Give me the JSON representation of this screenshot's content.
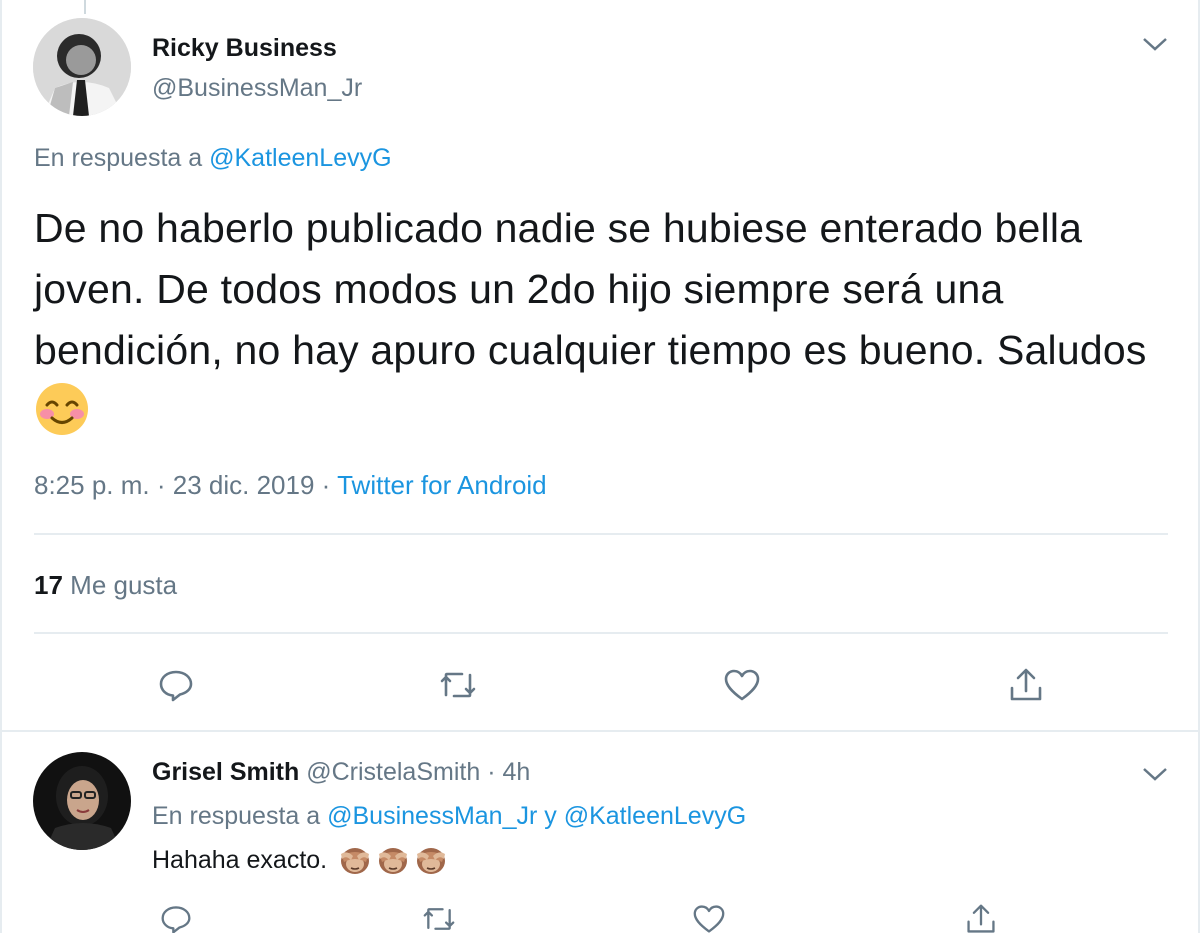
{
  "tweet": {
    "author_name": "Ricky Business",
    "author_handle": "@BusinessMan_Jr",
    "reply_prefix": "En respuesta a",
    "reply_to": "@KatleenLevyG",
    "text": "De no haberlo publicado nadie se hubiese enterado bella joven. De todos modos un 2do hijo siempre será una bendición, no hay apuro cualquier tiempo es bueno. Saludos",
    "emoji": "smiling-face-with-smiling-eyes",
    "time": "8:25 p. m.",
    "date": "23 dic. 2019",
    "dot": "·",
    "source": "Twitter for Android",
    "likes_count": "17",
    "likes_label": "Me gusta"
  },
  "reply": {
    "author_name": "Grisel Smith",
    "author_handle": "@CristelaSmith",
    "dot": "·",
    "age": "4h",
    "reply_prefix": "En respuesta a",
    "reply_to_1": "@BusinessMan_Jr",
    "conj": "y",
    "reply_to_2": "@KatleenLevyG",
    "text": "Hahaha exacto.",
    "emoji": "see-no-evil-monkey x3"
  },
  "icons": {
    "reply": "reply-icon",
    "retweet": "retweet-icon",
    "like": "heart-icon",
    "share": "share-icon",
    "more": "chevron-down-icon"
  },
  "colors": {
    "text": "#14171a",
    "muted": "#657786",
    "link": "#1b95e0",
    "border": "#e6ecf0"
  }
}
